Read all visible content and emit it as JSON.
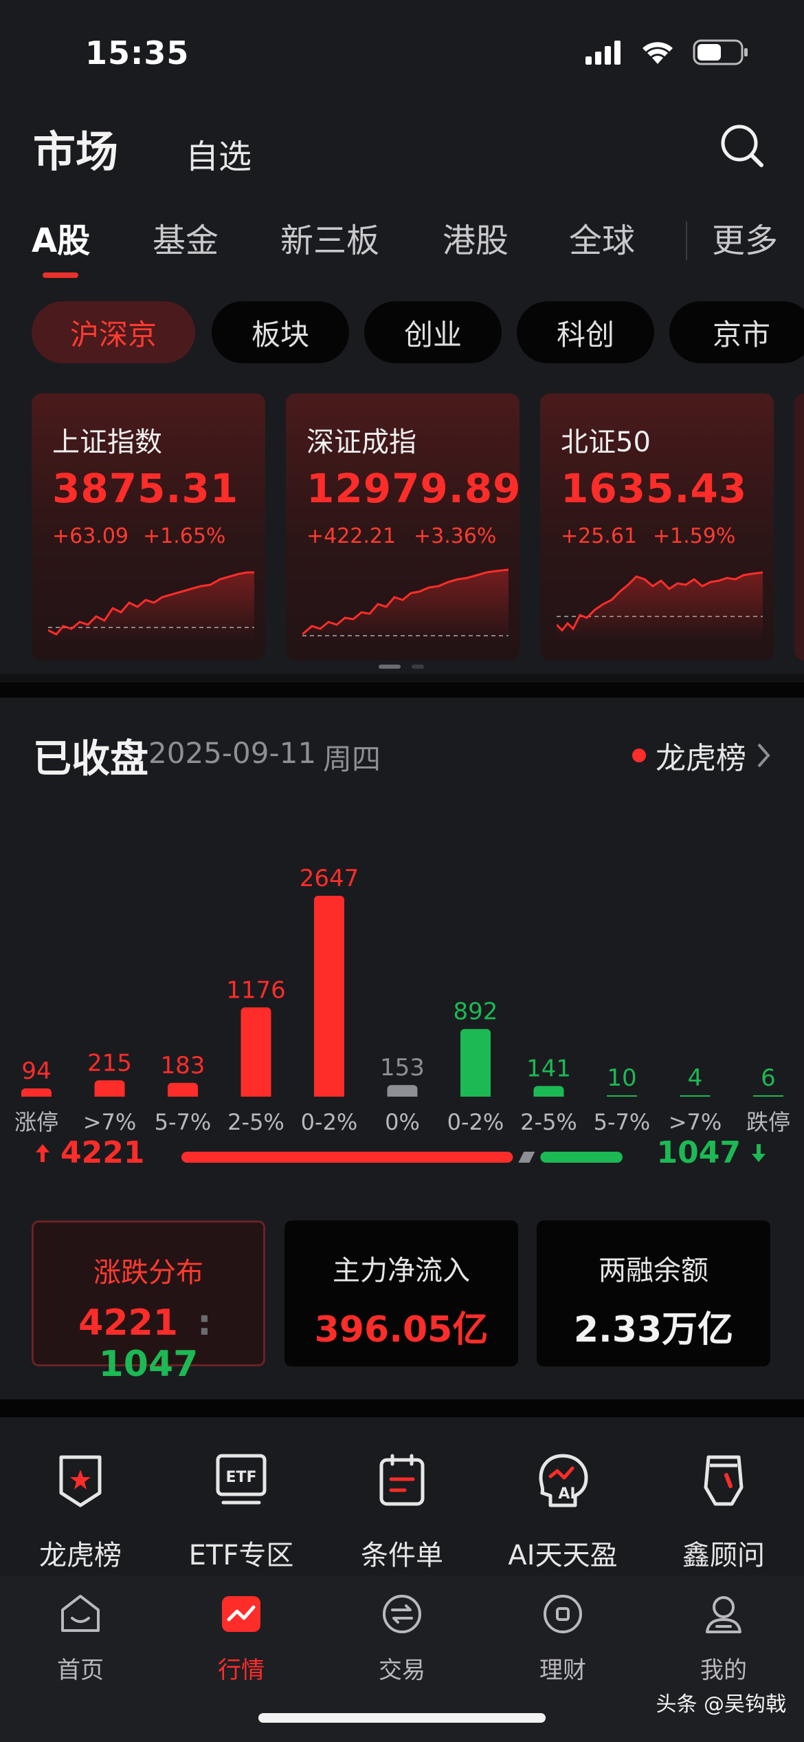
{
  "status": {
    "time": "15:35"
  },
  "header": {
    "title": "市场",
    "watchlist": "自选"
  },
  "tabs": [
    "A股",
    "基金",
    "新三板",
    "港股",
    "全球",
    "更多"
  ],
  "pills": [
    "沪深京",
    "板块",
    "创业",
    "科创",
    "京市"
  ],
  "indices": [
    {
      "name": "上证指数",
      "price": "3875.31",
      "change": "+63.09",
      "pct": "+1.65%"
    },
    {
      "name": "深证成指",
      "price": "12979.89",
      "change": "+422.21",
      "pct": "+3.36%"
    },
    {
      "name": "北证50",
      "price": "1635.43",
      "change": "+25.61",
      "pct": "+1.59%"
    }
  ],
  "overview": {
    "status": "已收盘",
    "date": "2025-09-11",
    "weekday": "周四",
    "lhb_link": "龙虎榜",
    "up_total": "4221",
    "down_total": "1047"
  },
  "chart_data": {
    "type": "bar",
    "categories": [
      "涨停",
      ">7%",
      "5-7%",
      "2-5%",
      "0-2%",
      "0%",
      "0-2%",
      "2-5%",
      "5-7%",
      ">7%",
      "跌停"
    ],
    "values": [
      94,
      215,
      183,
      1176,
      2647,
      153,
      892,
      141,
      10,
      4,
      6
    ],
    "colors": [
      "#ff2d2a",
      "#ff2d2a",
      "#ff2d2a",
      "#ff2d2a",
      "#ff2d2a",
      "#8e8f94",
      "#1db954",
      "#1db954",
      "#1db954",
      "#1db954",
      "#1db954"
    ],
    "ratio": {
      "up": 4221,
      "down": 1047
    }
  },
  "stats": [
    {
      "label": "涨跌分布",
      "up": "4221",
      "sep": ":",
      "down": "1047"
    },
    {
      "label": "主力净流入",
      "value": "396.05亿"
    },
    {
      "label": "两融余额",
      "value": "2.33万亿"
    }
  ],
  "tools": [
    "龙虎榜",
    "ETF专区",
    "条件单",
    "AI天天盈",
    "鑫顾问"
  ],
  "nav": [
    "首页",
    "行情",
    "交易",
    "理财",
    "我的"
  ],
  "watermark": "头条 @吴钩戟",
  "colors": {
    "up": "#ff2d2a",
    "down": "#1db954",
    "flat": "#8e8f94",
    "bg": "#1a1b1f"
  }
}
